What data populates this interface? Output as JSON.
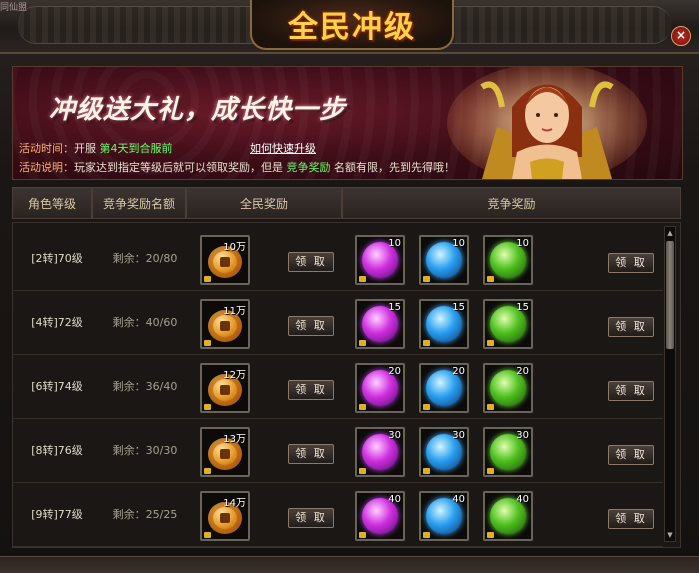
{
  "window": {
    "title": "全民冲级",
    "corner_text": "同仙盟",
    "close_glyph": "×"
  },
  "banner": {
    "slogan": "冲级送大礼，成长快一步",
    "time_label": "活动时间：",
    "time_prefix": "开服",
    "time_highlight": "第4天到合服前",
    "help_link": "如何快速升级",
    "desc_label": "活动说明：",
    "desc_text_1": "玩家达到指定等级后就可以领取奖励，但是",
    "desc_highlight": "竞争奖励",
    "desc_text_2": "名额有限，先到先得哦！"
  },
  "table": {
    "headers": [
      "角色等级",
      "竞争奖励名额",
      "全民奖励",
      "竞争奖励"
    ],
    "claim_label": "领 取",
    "rows": [
      {
        "level": "[2转]70级",
        "remaining": "剩余：20/80",
        "coin": "10万",
        "gems": [
          "10",
          "10",
          "10"
        ]
      },
      {
        "level": "[4转]72级",
        "remaining": "剩余：40/60",
        "coin": "11万",
        "gems": [
          "15",
          "15",
          "15"
        ]
      },
      {
        "level": "[6转]74级",
        "remaining": "剩余：36/40",
        "coin": "12万",
        "gems": [
          "20",
          "20",
          "20"
        ]
      },
      {
        "level": "[8转]76级",
        "remaining": "剩余：30/30",
        "coin": "13万",
        "gems": [
          "30",
          "30",
          "30"
        ]
      },
      {
        "level": "[9转]77级",
        "remaining": "剩余：25/25",
        "coin": "14万",
        "gems": [
          "40",
          "40",
          "40"
        ]
      }
    ]
  },
  "icons": {
    "coin": "copper-coin-icon",
    "gem_purple": "purple-gem-icon",
    "gem_blue": "blue-gem-icon",
    "gem_green": "green-gem-icon",
    "lock": "lock-icon"
  }
}
